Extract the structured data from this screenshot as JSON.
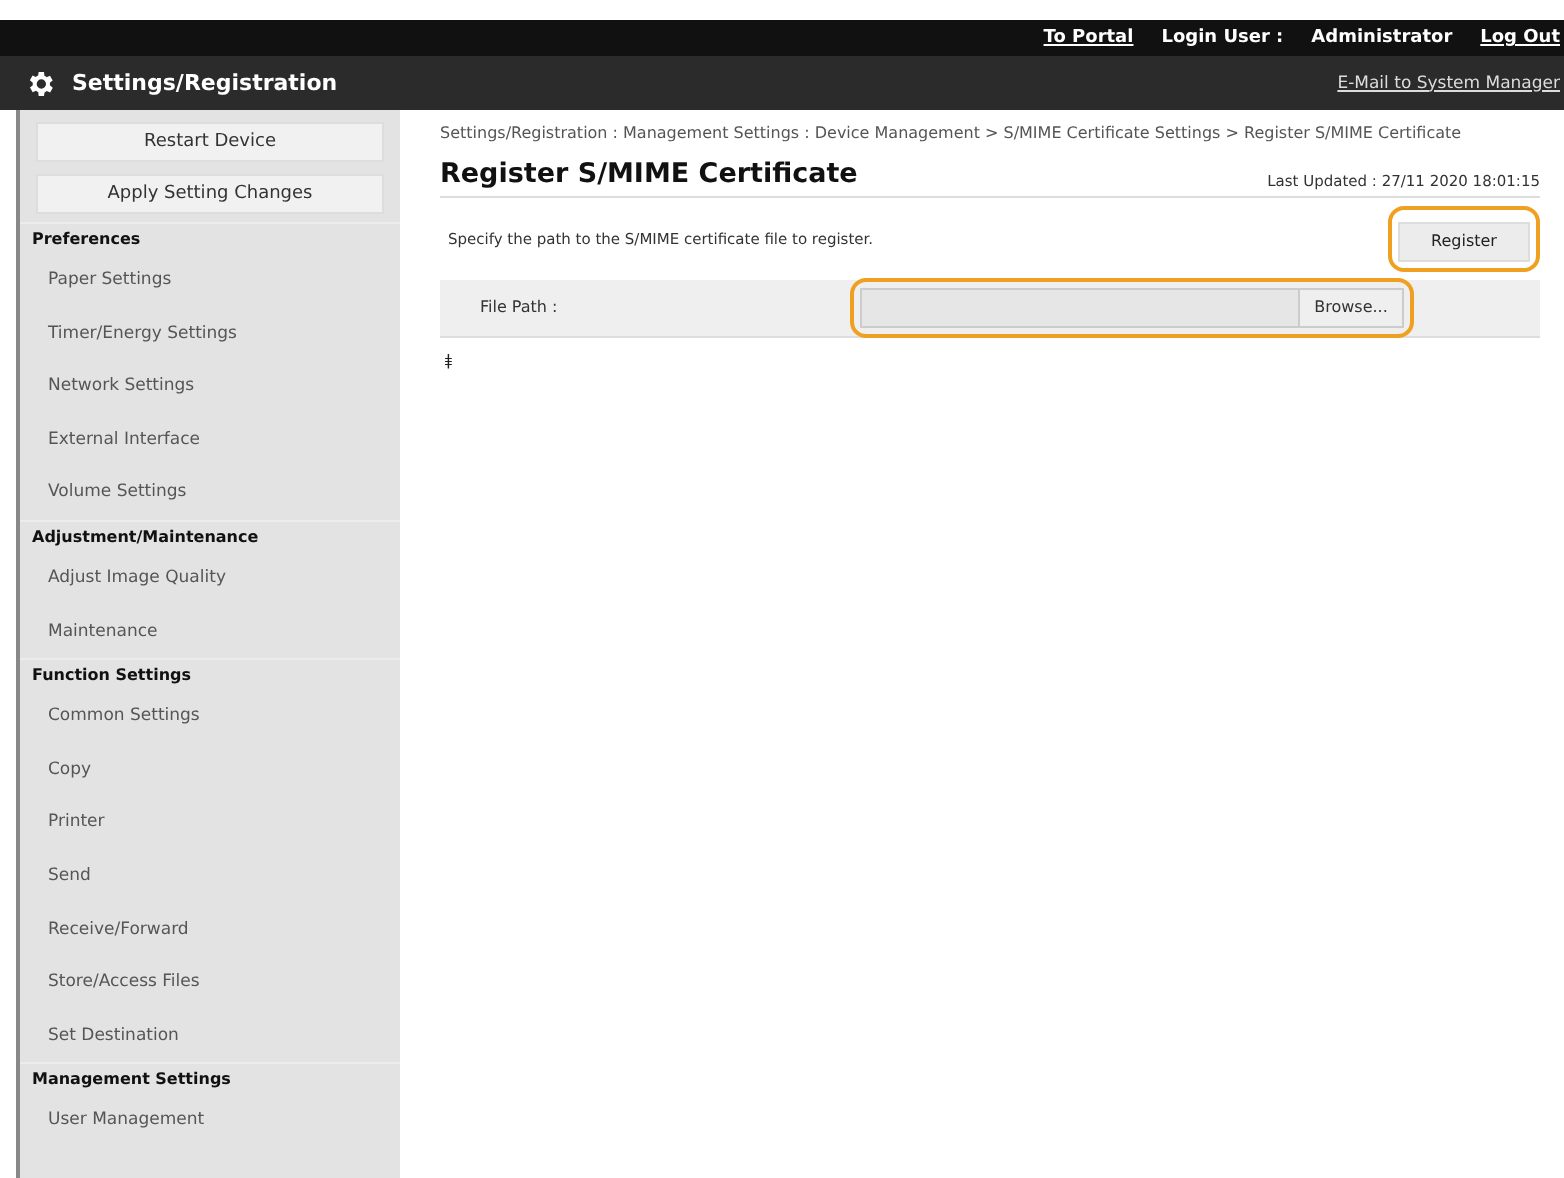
{
  "top_bar": {
    "links": [
      "To Portal"
    ],
    "login_label": "Login User :",
    "login_user": "Administrator",
    "logout": "Log Out"
  },
  "header": {
    "title": "Settings/Registration",
    "mail_link": "E-Mail to System Manager"
  },
  "sidebar": {
    "buttons": [
      "Restart Device",
      "Apply Setting Changes"
    ],
    "sections": [
      {
        "title": "Preferences",
        "items": [
          "Paper Settings",
          "Timer/Energy Settings",
          "Network Settings",
          "External Interface",
          "Volume Settings"
        ]
      },
      {
        "title": "Adjustment/Maintenance",
        "items": [
          "Adjust Image Quality",
          "Maintenance"
        ]
      },
      {
        "title": "Function Settings",
        "items": [
          "Common Settings",
          "Copy",
          "Printer",
          "Send",
          "Receive/Forward",
          "Store/Access Files",
          "Set Destination"
        ]
      },
      {
        "title": "Management Settings",
        "items": [
          "User Management"
        ]
      }
    ]
  },
  "main": {
    "breadcrumb": "Settings/Registration : Management Settings : Device Management > S/MIME Certificate Settings > Register S/MIME Certificate",
    "title": "Register S/MIME Certificate",
    "last_updated": "Last Updated : 27/11 2020 18:01:15",
    "description": "Specify the path to the S/MIME certificate file to register.",
    "register_button": {
      "label": "Register",
      "highlighted": true
    },
    "file_path": {
      "label": "File Path :",
      "browse": "Browse...",
      "highlighted": true
    },
    "top_link": "⯒"
  }
}
